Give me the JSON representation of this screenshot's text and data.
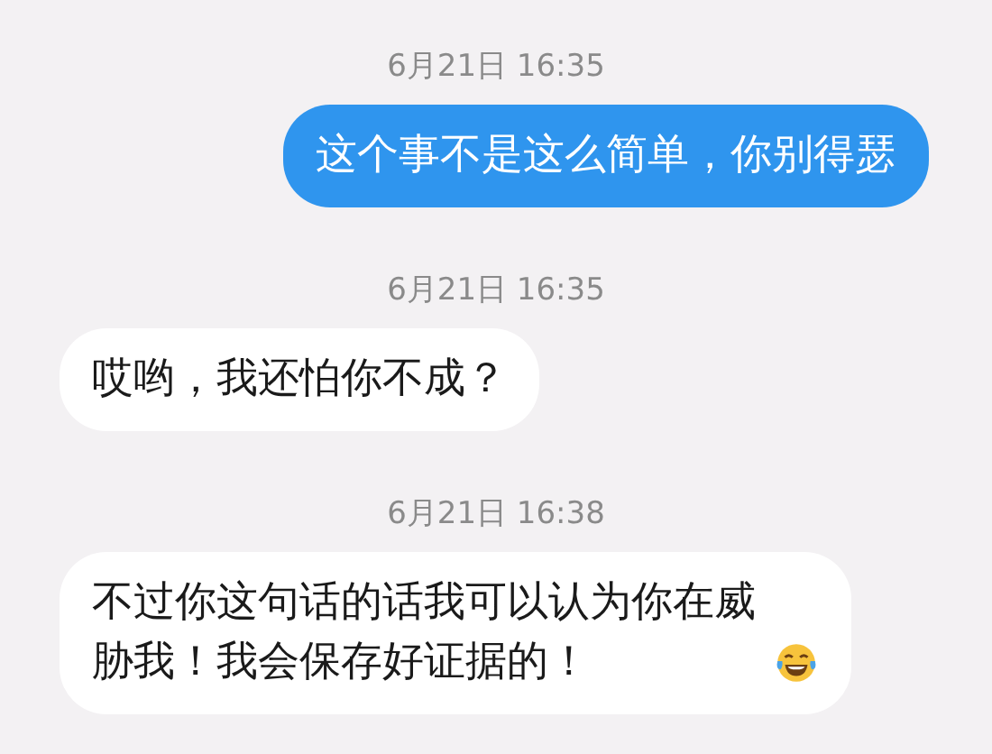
{
  "messages": [
    {
      "timestamp": "6月21日 16:35",
      "outgoing": true,
      "text": "这个事不是这么简单，你别得瑟",
      "emoji": false
    },
    {
      "timestamp": "6月21日 16:35",
      "outgoing": false,
      "text": "哎哟，我还怕你不成？",
      "emoji": false
    },
    {
      "timestamp": "6月21日 16:38",
      "outgoing": false,
      "text": "不过你这句话的话我可以认为你在威胁我！我会保存好证据的！",
      "emoji": true
    }
  ]
}
